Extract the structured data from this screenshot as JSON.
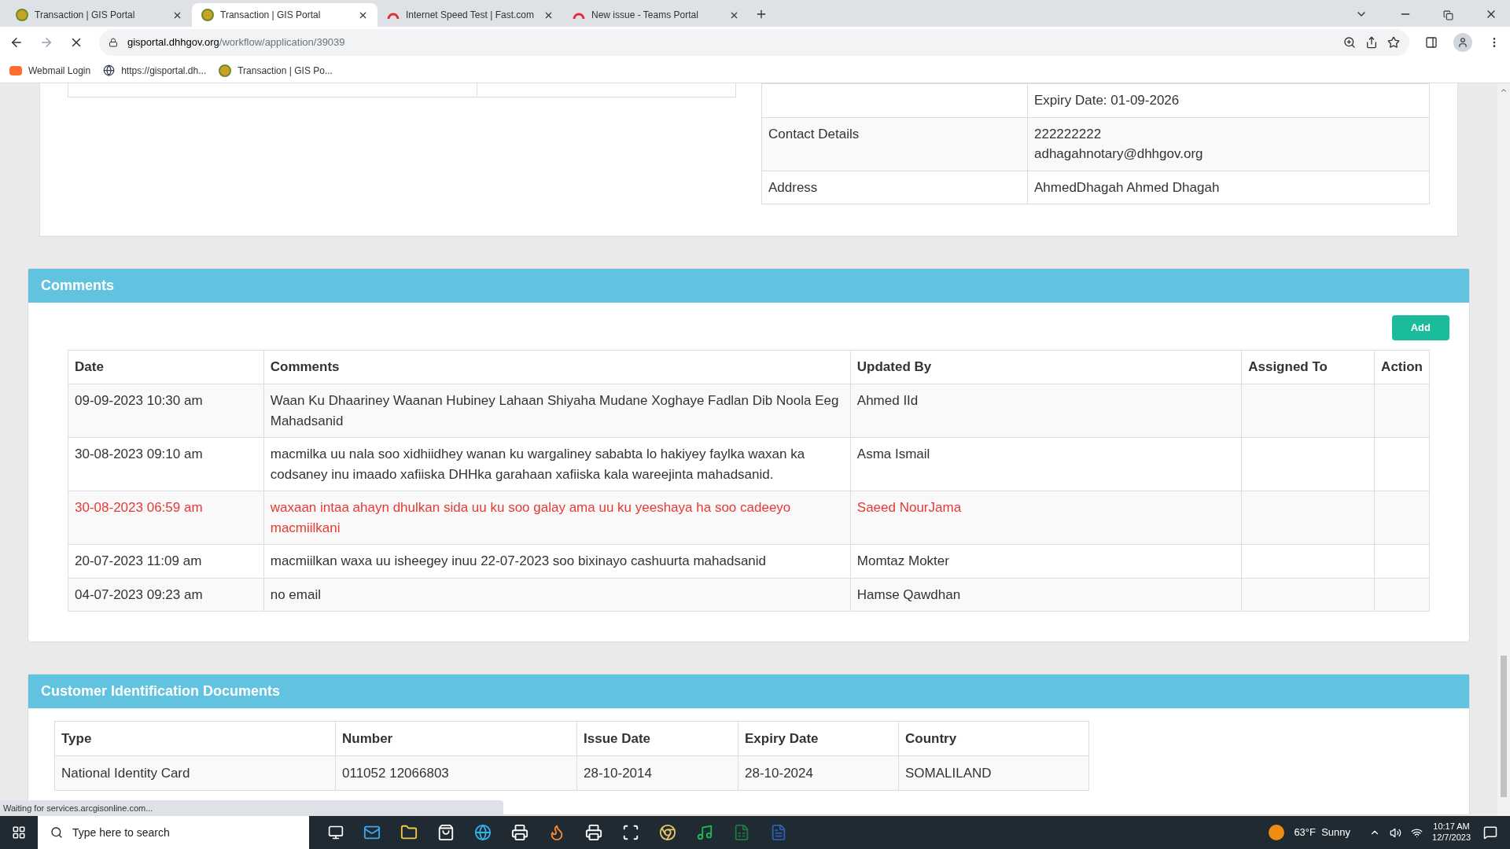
{
  "browser": {
    "tabs": [
      {
        "title": "Transaction | GIS Portal",
        "selected": false,
        "kind": "seal"
      },
      {
        "title": "Transaction | GIS Portal",
        "selected": true,
        "kind": "seal"
      },
      {
        "title": "Internet Speed Test | Fast.com",
        "selected": false,
        "kind": "gauge"
      },
      {
        "title": "New issue - Teams Portal",
        "selected": false,
        "kind": "gauge"
      }
    ],
    "url_host": "gisportal.dhhgov.org",
    "url_path": "/workflow/application/39039",
    "bookmarks": [
      {
        "label": "Webmail Login",
        "kind": "cpanel"
      },
      {
        "label": "https://gisportal.dh...",
        "kind": "globe"
      },
      {
        "label": "Transaction | GIS Po...",
        "kind": "seal"
      }
    ]
  },
  "details": {
    "rows": [
      {
        "label": "",
        "lines": [
          "Expiry Date: 01-09-2026"
        ]
      },
      {
        "label": "Contact Details",
        "lines": [
          "222222222",
          "adhagahnotary@dhhgov.org"
        ]
      },
      {
        "label": "Address",
        "lines": [
          "AhmedDhagah Ahmed Dhagah"
        ]
      }
    ]
  },
  "comments": {
    "title": "Comments",
    "add_button": "Add",
    "columns": [
      "Date",
      "Comments",
      "Updated By",
      "Assigned To",
      "Action"
    ],
    "rows": [
      {
        "date": "09-09-2023 10:30 am",
        "comment": "Waan Ku Dhaariney Waanan Hubiney Lahaan Shiyaha Mudane Xoghaye Fadlan Dib Noola Eeg Mahadsanid",
        "updated_by": "Ahmed IId",
        "flagged": false
      },
      {
        "date": "30-08-2023 09:10 am",
        "comment": "macmilka uu nala soo xidhiidhey wanan ku wargaliney sababta lo hakiyey faylka waxan ka codsaney inu imaado xafiiska DHHka garahaan xafiiska kala wareejinta mahadsanid.",
        "updated_by": "Asma Ismail",
        "flagged": false
      },
      {
        "date": "30-08-2023 06:59 am",
        "comment": "waxaan intaa ahayn dhulkan sida uu ku soo galay ama uu ku yeeshaya ha soo cadeeyo macmiilkani",
        "updated_by": "Saeed NourJama",
        "flagged": true
      },
      {
        "date": "20-07-2023 11:09 am",
        "comment": "macmiilkan waxa uu isheegey inuu 22-07-2023 soo bixinayo cashuurta mahadsanid",
        "updated_by": "Momtaz Mokter",
        "flagged": false
      },
      {
        "date": "04-07-2023 09:23 am",
        "comment": "no email",
        "updated_by": "Hamse Qawdhan",
        "flagged": false
      }
    ]
  },
  "documents": {
    "title": "Customer Identification Documents",
    "columns": [
      "Type",
      "Number",
      "Issue Date",
      "Expiry Date",
      "Country"
    ],
    "rows": [
      [
        "National Identity Card",
        "011052 12066803",
        "28-10-2014",
        "28-10-2024",
        "SOMALILAND"
      ]
    ]
  },
  "status": "Waiting for services.arcgisonline.com...",
  "taskbar": {
    "search_placeholder": "Type here to search",
    "weather": "63°F  Sunny",
    "time": "10:17 AM",
    "date": "12/7/2023"
  }
}
